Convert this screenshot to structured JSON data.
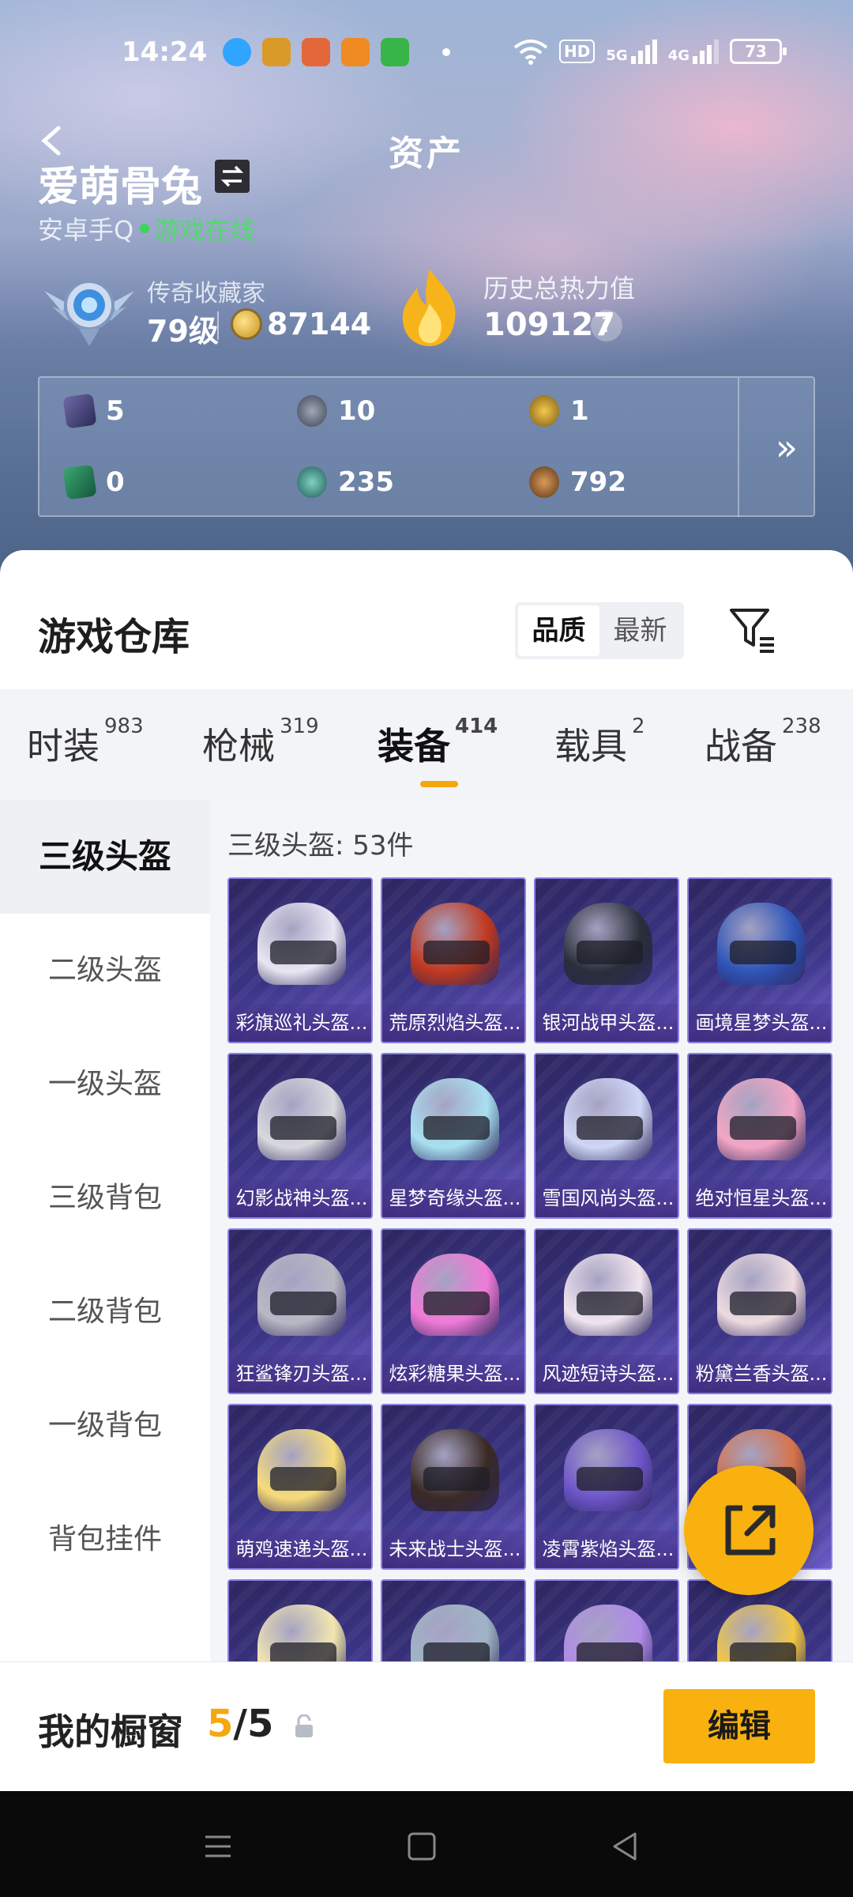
{
  "status_bar": {
    "time": "14:24",
    "hd_label": "HD",
    "net1": "5G",
    "net2": "4G",
    "battery": "73"
  },
  "header": {
    "title": "资产",
    "nickname": "爱萌骨兔",
    "platform": "安卓手Q",
    "online_status": "游戏在线"
  },
  "profile": {
    "rank_title": "传奇收藏家",
    "level": "79级",
    "coins": "87144",
    "heat_label": "历史总热力值",
    "heat_value": "109127",
    "help": "?"
  },
  "stats": [
    {
      "icon": "card-purple-icon",
      "value": "5"
    },
    {
      "icon": "medal-silver-icon",
      "value": "10"
    },
    {
      "icon": "medal-gold-icon",
      "value": "1"
    },
    {
      "icon": "card-green-icon",
      "value": "0"
    },
    {
      "icon": "orb-teal-icon",
      "value": "235"
    },
    {
      "icon": "orb-bronze-icon",
      "value": "792"
    }
  ],
  "more": "»",
  "warehouse": {
    "title": "游戏仓库",
    "sort_options": [
      "品质",
      "最新"
    ],
    "sort_selected": "品质"
  },
  "category_tabs": [
    {
      "label": "时装",
      "count": "983"
    },
    {
      "label": "枪械",
      "count": "319"
    },
    {
      "label": "装备",
      "count": "414"
    },
    {
      "label": "载具",
      "count": "2"
    },
    {
      "label": "战备",
      "count": "238"
    }
  ],
  "active_tab": "装备",
  "side_nav": [
    "三级头盔",
    "二级头盔",
    "一级头盔",
    "三级背包",
    "二级背包",
    "一级背包",
    "背包挂件"
  ],
  "grid": {
    "heading": "三级头盔: 53件",
    "items": [
      {
        "name": "彩旗巡礼头盔...",
        "color": "#e8e6f2"
      },
      {
        "name": "荒原烈焰头盔...",
        "color": "#c0391f"
      },
      {
        "name": "银河战甲头盔...",
        "color": "#2a2f3a"
      },
      {
        "name": "画境星梦头盔...",
        "color": "#2f55b8"
      },
      {
        "name": "幻影战神头盔...",
        "color": "#d8d8de"
      },
      {
        "name": "星梦奇缘头盔...",
        "color": "#a8e0f0"
      },
      {
        "name": "雪国风尚头盔...",
        "color": "#cfd6f6"
      },
      {
        "name": "绝对恒星头盔...",
        "color": "#f3a6c4"
      },
      {
        "name": "狂鲨锋刃头盔...",
        "color": "#b8b8c4"
      },
      {
        "name": "炫彩糖果头盔...",
        "color": "#f07ad6"
      },
      {
        "name": "风迹短诗头盔...",
        "color": "#f0e4ee"
      },
      {
        "name": "粉黛兰香头盔...",
        "color": "#eedbe0"
      },
      {
        "name": "萌鸡速递头盔...",
        "color": "#f7dc7a"
      },
      {
        "name": "未来战士头盔...",
        "color": "#3a2a24"
      },
      {
        "name": "凌霄紫焰头盔...",
        "color": "#6e55c8"
      },
      {
        "name": "",
        "color": "#d6734a"
      },
      {
        "name": "",
        "color": "#f2e7b0"
      },
      {
        "name": "",
        "color": "#9fb4c6"
      },
      {
        "name": "",
        "color": "#b08be8"
      },
      {
        "name": "",
        "color": "#f2c842"
      }
    ]
  },
  "showcase": {
    "label": "我的橱窗",
    "current": "5",
    "separator": "/",
    "total": "5",
    "edit_label": "编辑"
  },
  "colors": {
    "accent": "#f8b10e",
    "online": "#52d96c",
    "card_border": "#8d7fe6"
  }
}
